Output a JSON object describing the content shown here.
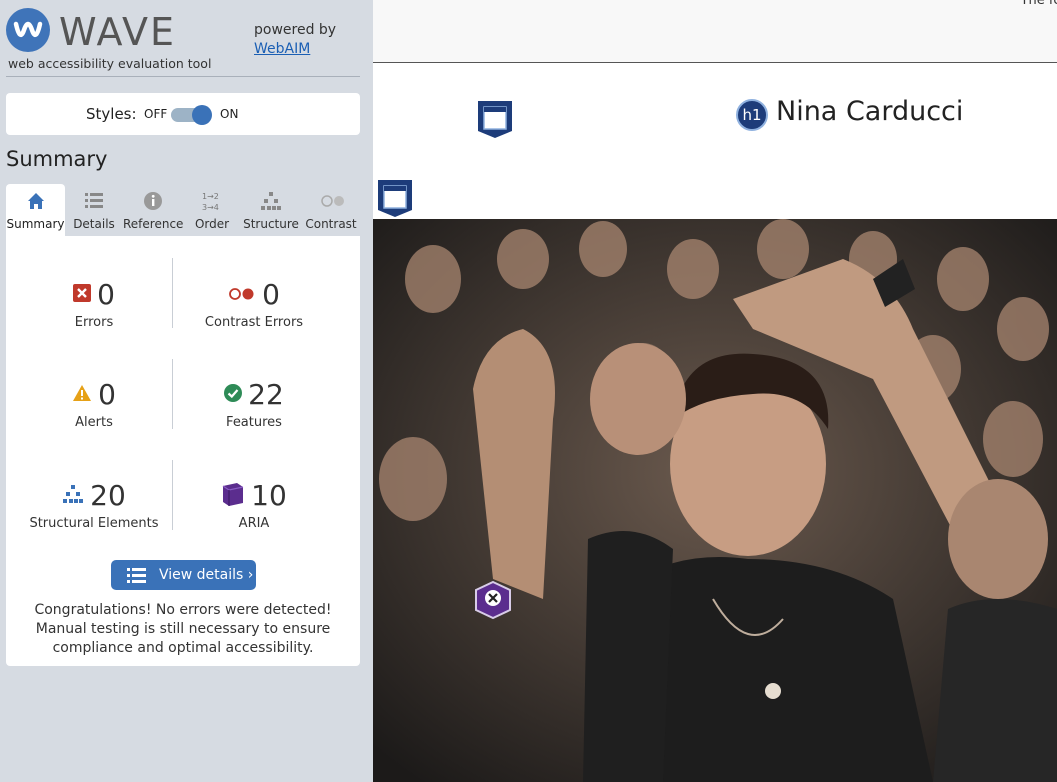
{
  "wave": {
    "logo_text": "WAVE",
    "tagline": "web accessibility evaluation tool",
    "powered_by": "powered by",
    "webaim_link": "WebAIM"
  },
  "styles": {
    "label": "Styles:",
    "off": "OFF",
    "on": "ON",
    "state": "on"
  },
  "summary_heading": "Summary",
  "tabs": [
    {
      "label": "Summary",
      "icon": "home-icon",
      "active": true
    },
    {
      "label": "Details",
      "icon": "list-icon",
      "active": false
    },
    {
      "label": "Reference",
      "icon": "info-icon",
      "active": false
    },
    {
      "label": "Order",
      "icon": "order-icon",
      "active": false
    },
    {
      "label": "Structure",
      "icon": "structure-icon",
      "active": false
    },
    {
      "label": "Contrast",
      "icon": "contrast-icon",
      "active": false
    }
  ],
  "stats": {
    "errors": {
      "count": "0",
      "label": "Errors",
      "color": "#c0392b"
    },
    "contrast_errors": {
      "count": "0",
      "label": "Contrast Errors",
      "color": "#c0392b"
    },
    "alerts": {
      "count": "0",
      "label": "Alerts",
      "color": "#e6a117"
    },
    "features": {
      "count": "22",
      "label": "Features",
      "color": "#2e8b57"
    },
    "structural": {
      "count": "20",
      "label": "Structural Elements",
      "color": "#3a72b8"
    },
    "aria": {
      "count": "10",
      "label": "ARIA",
      "color": "#5b2d8e"
    }
  },
  "view_details_label": "View details ›",
  "congrats_text": "Congratulations! No errors were detected! Manual testing is still necessary to ensure compliance and optimal accessibility.",
  "page": {
    "header_text": "The fol",
    "hero_name": "Nina Carducci",
    "h1_badge": "h1"
  },
  "colors": {
    "sidebar_bg": "#d6dbe2",
    "accent": "#3a72b8",
    "aria_purple": "#5b2d8e"
  }
}
